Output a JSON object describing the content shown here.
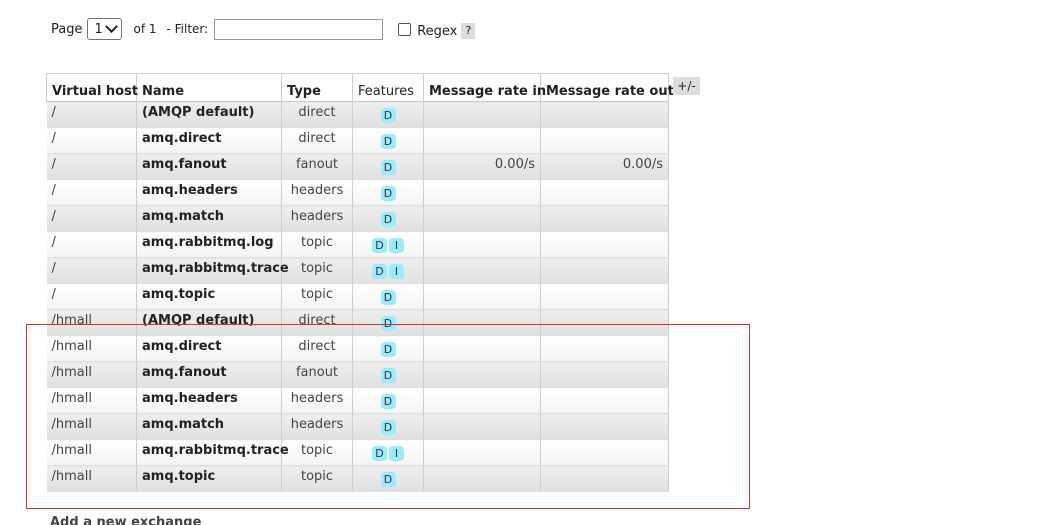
{
  "pager": {
    "page_label": "Page",
    "page_value": "1",
    "of_label": "of 1",
    "filter_label": "- Filter:",
    "filter_value": "",
    "regex_label": "Regex",
    "help_label": "?"
  },
  "table": {
    "headers": [
      "Virtual host",
      "Name",
      "Type",
      "Features",
      "Message rate in",
      "Message rate out"
    ],
    "toggle_label": "+/-",
    "rows": [
      {
        "vhost": "/",
        "name": "(AMQP default)",
        "type": "direct",
        "features": [
          "D"
        ],
        "rate_in": "",
        "rate_out": ""
      },
      {
        "vhost": "/",
        "name": "amq.direct",
        "type": "direct",
        "features": [
          "D"
        ],
        "rate_in": "",
        "rate_out": ""
      },
      {
        "vhost": "/",
        "name": "amq.fanout",
        "type": "fanout",
        "features": [
          "D"
        ],
        "rate_in": "0.00/s",
        "rate_out": "0.00/s"
      },
      {
        "vhost": "/",
        "name": "amq.headers",
        "type": "headers",
        "features": [
          "D"
        ],
        "rate_in": "",
        "rate_out": ""
      },
      {
        "vhost": "/",
        "name": "amq.match",
        "type": "headers",
        "features": [
          "D"
        ],
        "rate_in": "",
        "rate_out": ""
      },
      {
        "vhost": "/",
        "name": "amq.rabbitmq.log",
        "type": "topic",
        "features": [
          "D",
          "I"
        ],
        "rate_in": "",
        "rate_out": ""
      },
      {
        "vhost": "/",
        "name": "amq.rabbitmq.trace",
        "type": "topic",
        "features": [
          "D",
          "I"
        ],
        "rate_in": "",
        "rate_out": ""
      },
      {
        "vhost": "/",
        "name": "amq.topic",
        "type": "topic",
        "features": [
          "D"
        ],
        "rate_in": "",
        "rate_out": ""
      },
      {
        "vhost": "/hmall",
        "name": "(AMQP default)",
        "type": "direct",
        "features": [
          "D"
        ],
        "rate_in": "",
        "rate_out": ""
      },
      {
        "vhost": "/hmall",
        "name": "amq.direct",
        "type": "direct",
        "features": [
          "D"
        ],
        "rate_in": "",
        "rate_out": ""
      },
      {
        "vhost": "/hmall",
        "name": "amq.fanout",
        "type": "fanout",
        "features": [
          "D"
        ],
        "rate_in": "",
        "rate_out": ""
      },
      {
        "vhost": "/hmall",
        "name": "amq.headers",
        "type": "headers",
        "features": [
          "D"
        ],
        "rate_in": "",
        "rate_out": ""
      },
      {
        "vhost": "/hmall",
        "name": "amq.match",
        "type": "headers",
        "features": [
          "D"
        ],
        "rate_in": "",
        "rate_out": ""
      },
      {
        "vhost": "/hmall",
        "name": "amq.rabbitmq.trace",
        "type": "topic",
        "features": [
          "D",
          "I"
        ],
        "rate_in": "",
        "rate_out": ""
      },
      {
        "vhost": "/hmall",
        "name": "amq.topic",
        "type": "topic",
        "features": [
          "D"
        ],
        "rate_in": "",
        "rate_out": ""
      }
    ]
  },
  "add_section": {
    "label": "Add a new exchange"
  },
  "colors": {
    "badge": "#99ebff",
    "highlight": "#d93030"
  }
}
